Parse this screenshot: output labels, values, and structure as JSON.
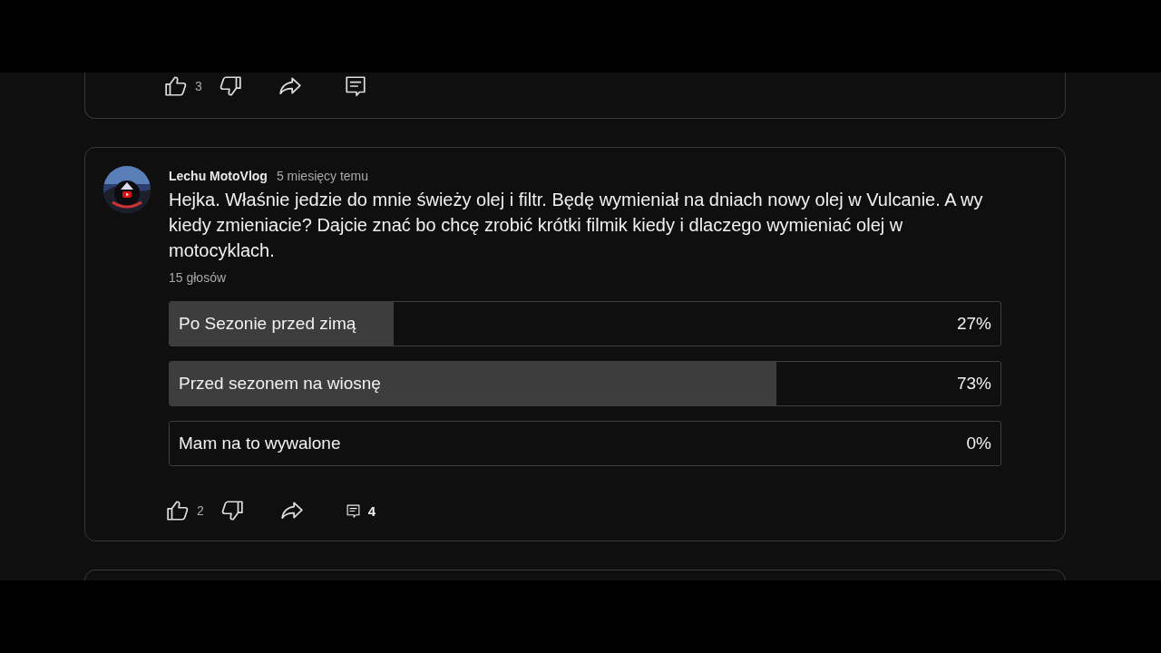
{
  "posts": [
    {
      "actions": {
        "likes": "3"
      }
    },
    {
      "author": "Lechu MotoVlog",
      "time": "5 miesięcy temu",
      "text": "Hejka. Właśnie jedzie do mnie świeży olej i filtr. Będę wymieniał na dniach nowy olej w Vulcanie. A wy kiedy zmieniacie? Dajcie znać bo chcę zrobić krótki filmik kiedy i dlaczego wymieniać olej w motocyklach.",
      "votes": "15 głosów",
      "poll": [
        {
          "label": "Po Sezonie przed zimą",
          "percent": "27%",
          "level": 0.27
        },
        {
          "label": "Przed sezonem na wiosnę",
          "percent": "73%",
          "level": 0.73
        },
        {
          "label": "Mam na to wywalone",
          "percent": "0%",
          "level": 0
        }
      ],
      "actions": {
        "likes": "2",
        "replies": "4"
      }
    }
  ]
}
